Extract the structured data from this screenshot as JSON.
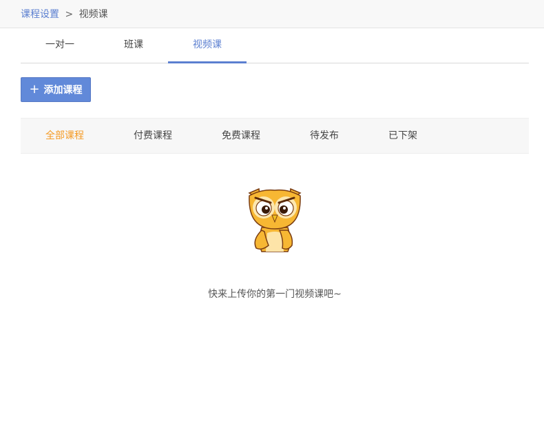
{
  "breadcrumb": {
    "parent": "课程设置",
    "separator": ">",
    "current": "视频课"
  },
  "tabs": [
    {
      "label": "一对一",
      "active": false
    },
    {
      "label": "班课",
      "active": false
    },
    {
      "label": "视频课",
      "active": true
    }
  ],
  "toolbar": {
    "add_icon": "plus-icon",
    "add_label": "添加课程"
  },
  "filters": [
    {
      "label": "全部课程",
      "active": true
    },
    {
      "label": "付费课程",
      "active": false
    },
    {
      "label": "免费课程",
      "active": false
    },
    {
      "label": "待发布",
      "active": false
    },
    {
      "label": "已下架",
      "active": false
    }
  ],
  "empty_state": {
    "illustration": "owl-illustration",
    "message": "快来上传你的第一门视频课吧~"
  },
  "colors": {
    "accent": "#5b7fd0",
    "button": "#6189d9",
    "active_filter": "#f59a23"
  }
}
